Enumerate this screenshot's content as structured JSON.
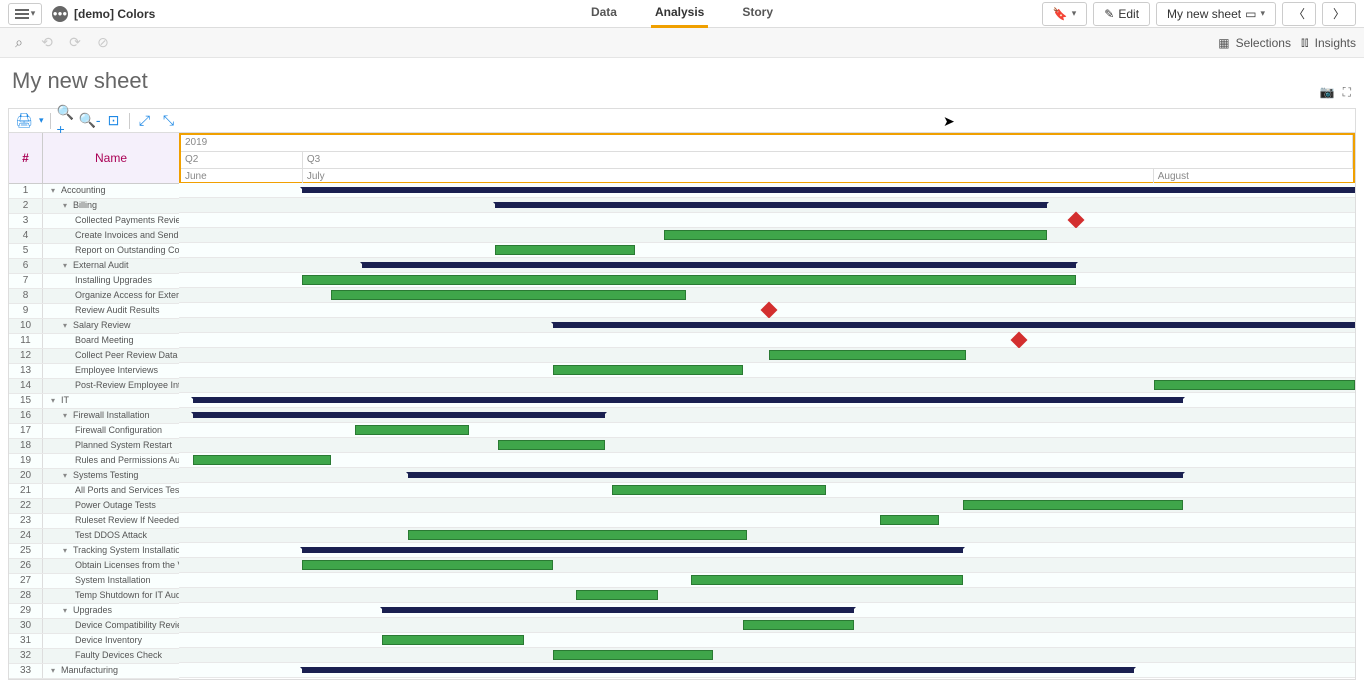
{
  "app": {
    "title": "[demo] Colors"
  },
  "tabs": {
    "data": "Data",
    "analysis": "Analysis",
    "story": "Story"
  },
  "buttons": {
    "bookmark": "",
    "edit": "Edit",
    "sheet": "My new sheet"
  },
  "selbar": {
    "selections": "Selections",
    "insights": "Insights"
  },
  "sheet_title": "My new sheet",
  "headers": {
    "num": "#",
    "name": "Name",
    "year": "2019",
    "q2": "Q2",
    "q3": "Q3",
    "june": "June",
    "july": "July",
    "august": "August"
  },
  "rows": [
    {
      "n": 1,
      "name": "Accounting",
      "indent": 0,
      "exp": true,
      "bar": {
        "type": "summary",
        "start": 10.5,
        "end": 100
      }
    },
    {
      "n": 2,
      "name": "Billing",
      "indent": 1,
      "exp": true,
      "bar": {
        "type": "summary",
        "start": 26.9,
        "end": 73.8
      }
    },
    {
      "n": 3,
      "name": "Collected Payments Review",
      "indent": 2,
      "bar": {
        "type": "milestone",
        "at": 76.3
      }
    },
    {
      "n": 4,
      "name": "Create Invoices and Send Invoices",
      "indent": 2,
      "bar": {
        "type": "task",
        "start": 41.2,
        "end": 73.8
      }
    },
    {
      "n": 5,
      "name": "Report on Outstanding Collections",
      "indent": 2,
      "bar": {
        "type": "task",
        "start": 26.9,
        "end": 38.8
      }
    },
    {
      "n": 6,
      "name": "External Audit",
      "indent": 1,
      "exp": true,
      "bar": {
        "type": "summary",
        "start": 15.6,
        "end": 76.3
      }
    },
    {
      "n": 7,
      "name": "Installing Upgrades",
      "indent": 2,
      "bar": {
        "type": "task",
        "start": 10.5,
        "end": 76.3
      }
    },
    {
      "n": 8,
      "name": "Organize Access for External Auditors",
      "indent": 2,
      "bar": {
        "type": "task",
        "start": 12.9,
        "end": 43.1
      }
    },
    {
      "n": 9,
      "name": "Review Audit Results",
      "indent": 2,
      "bar": {
        "type": "milestone",
        "at": 50.2
      }
    },
    {
      "n": 10,
      "name": "Salary Review",
      "indent": 1,
      "exp": true,
      "bar": {
        "type": "summary",
        "start": 31.8,
        "end": 100
      }
    },
    {
      "n": 11,
      "name": "Board Meeting",
      "indent": 2,
      "bar": {
        "type": "milestone",
        "at": 71.4
      }
    },
    {
      "n": 12,
      "name": "Collect Peer Review Data",
      "indent": 2,
      "bar": {
        "type": "task",
        "start": 50.2,
        "end": 66.9
      }
    },
    {
      "n": 13,
      "name": "Employee Interviews",
      "indent": 2,
      "bar": {
        "type": "task",
        "start": 31.8,
        "end": 48.0
      }
    },
    {
      "n": 14,
      "name": "Post-Review Employee Interviews",
      "indent": 2,
      "bar": {
        "type": "task",
        "start": 82.9,
        "end": 100
      }
    },
    {
      "n": 15,
      "name": "IT",
      "indent": 0,
      "exp": true,
      "bar": {
        "type": "summary",
        "start": 1.2,
        "end": 85.4
      }
    },
    {
      "n": 16,
      "name": "Firewall Installation",
      "indent": 1,
      "exp": true,
      "bar": {
        "type": "summary",
        "start": 1.2,
        "end": 36.2
      }
    },
    {
      "n": 17,
      "name": "Firewall Configuration",
      "indent": 2,
      "bar": {
        "type": "task",
        "start": 15.0,
        "end": 24.7
      }
    },
    {
      "n": 18,
      "name": "Planned System Restart",
      "indent": 2,
      "bar": {
        "type": "task",
        "start": 27.1,
        "end": 36.2
      }
    },
    {
      "n": 19,
      "name": "Rules and Permissions Audit",
      "indent": 2,
      "bar": {
        "type": "task",
        "start": 1.2,
        "end": 12.9
      }
    },
    {
      "n": 20,
      "name": "Systems Testing",
      "indent": 1,
      "exp": true,
      "bar": {
        "type": "summary",
        "start": 19.5,
        "end": 85.4
      }
    },
    {
      "n": 21,
      "name": "All Ports and Services Test",
      "indent": 2,
      "bar": {
        "type": "task",
        "start": 36.8,
        "end": 55.0
      }
    },
    {
      "n": 22,
      "name": "Power Outage Tests",
      "indent": 2,
      "bar": {
        "type": "task",
        "start": 66.7,
        "end": 85.4
      }
    },
    {
      "n": 23,
      "name": "Ruleset Review If Needed",
      "indent": 2,
      "bar": {
        "type": "task",
        "start": 59.6,
        "end": 64.6
      }
    },
    {
      "n": 24,
      "name": "Test DDOS Attack",
      "indent": 2,
      "bar": {
        "type": "task",
        "start": 19.5,
        "end": 48.3
      }
    },
    {
      "n": 25,
      "name": "Tracking System Installation",
      "indent": 1,
      "exp": true,
      "bar": {
        "type": "summary",
        "start": 10.5,
        "end": 66.7
      }
    },
    {
      "n": 26,
      "name": "Obtain Licenses from the Vendor",
      "indent": 2,
      "bar": {
        "type": "task",
        "start": 10.5,
        "end": 31.8
      }
    },
    {
      "n": 27,
      "name": "System Installation",
      "indent": 2,
      "bar": {
        "type": "task",
        "start": 43.5,
        "end": 66.7
      }
    },
    {
      "n": 28,
      "name": "Temp Shutdown for IT Audit",
      "indent": 2,
      "bar": {
        "type": "task",
        "start": 33.8,
        "end": 40.7
      }
    },
    {
      "n": 29,
      "name": "Upgrades",
      "indent": 1,
      "exp": true,
      "bar": {
        "type": "summary",
        "start": 17.3,
        "end": 57.4
      }
    },
    {
      "n": 30,
      "name": "Device Compatibility Review",
      "indent": 2,
      "bar": {
        "type": "task",
        "start": 48.0,
        "end": 57.4
      }
    },
    {
      "n": 31,
      "name": "Device Inventory",
      "indent": 2,
      "bar": {
        "type": "task",
        "start": 17.3,
        "end": 29.3
      }
    },
    {
      "n": 32,
      "name": "Faulty Devices Check",
      "indent": 2,
      "bar": {
        "type": "task",
        "start": 31.8,
        "end": 45.4
      }
    },
    {
      "n": 33,
      "name": "Manufacturing",
      "indent": 0,
      "exp": true,
      "bar": {
        "type": "summary",
        "start": 10.5,
        "end": 81.2
      }
    }
  ],
  "chart_data": {
    "type": "gantt",
    "title": "",
    "time_axis": {
      "year": "2019",
      "quarters": [
        "Q2",
        "Q3"
      ],
      "months": [
        "June",
        "July",
        "August"
      ]
    },
    "tasks": "See rows array above for task name, type (summary/task/milestone) and start/end percentages across visible range (June–August 2019)."
  }
}
